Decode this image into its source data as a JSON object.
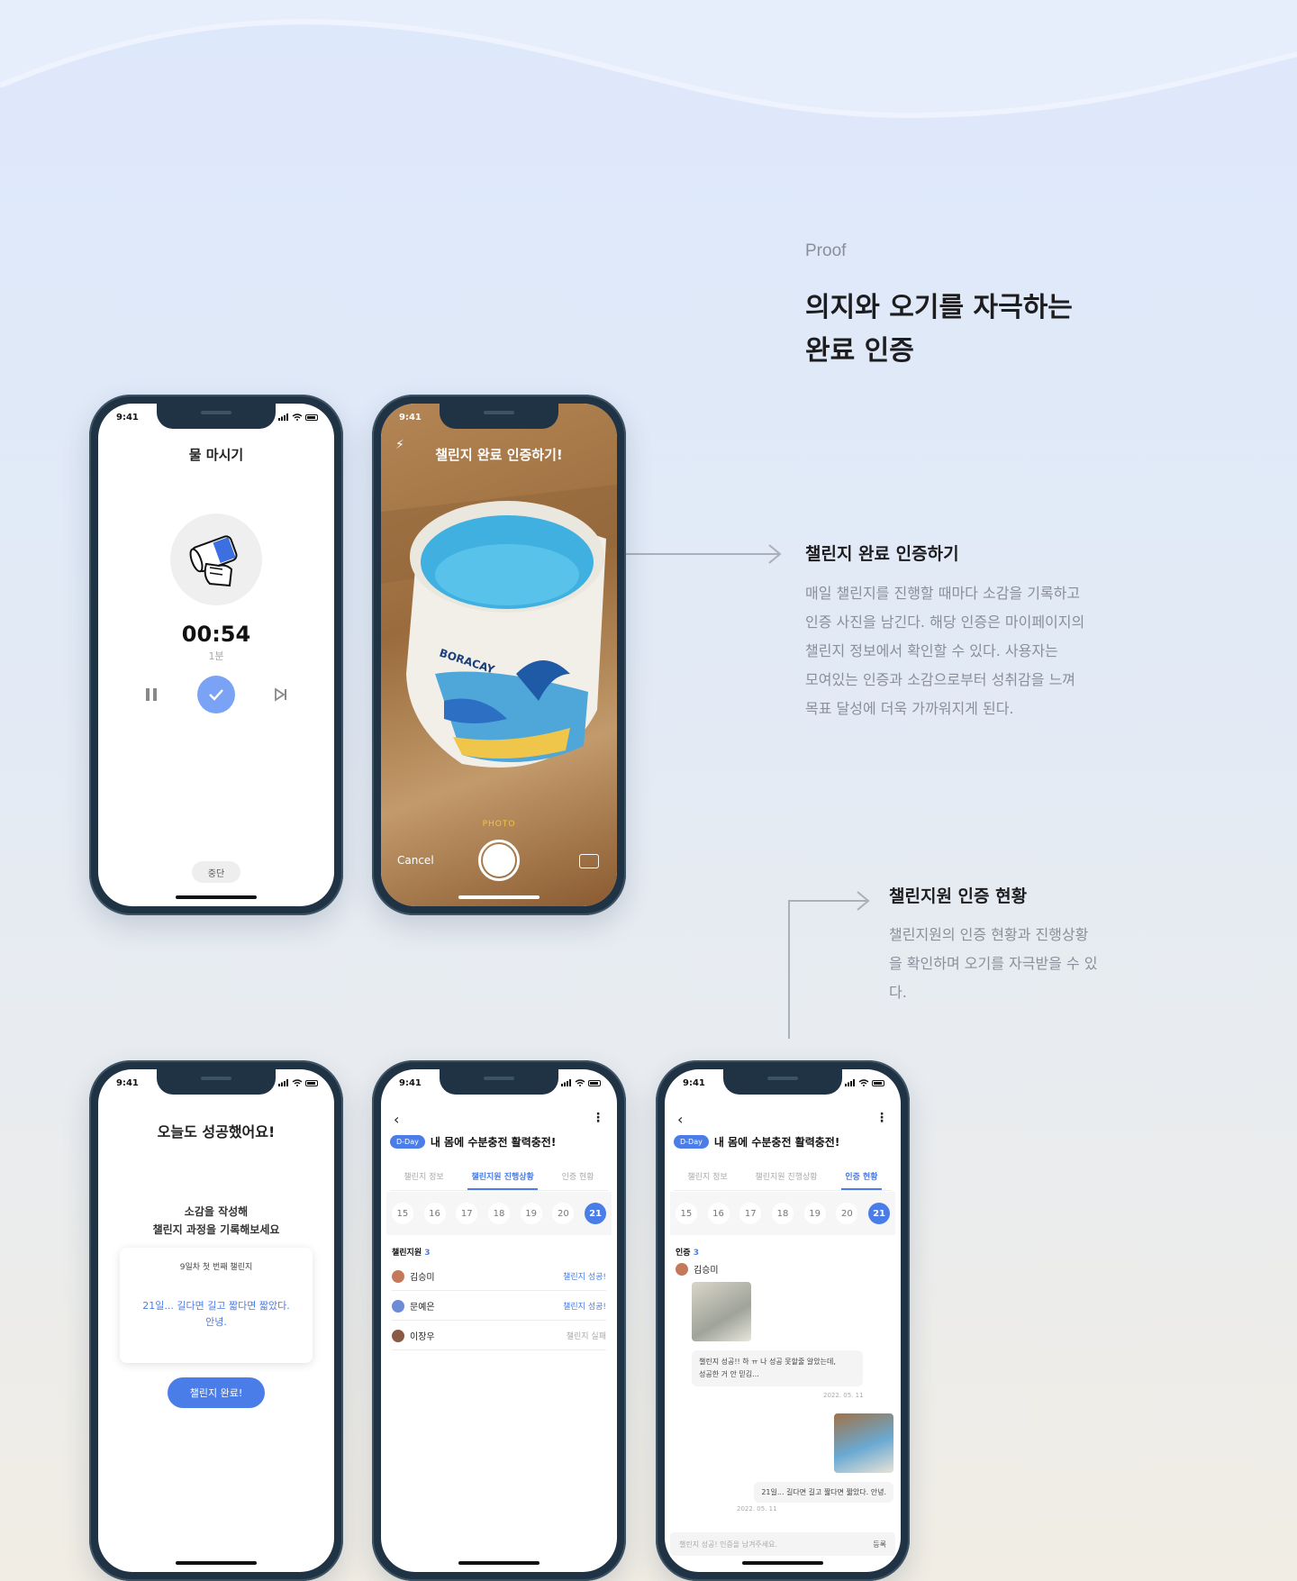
{
  "section": {
    "label": "Proof",
    "title_line1": "의지와 오기를 자극하는",
    "title_line2": "완료 인증"
  },
  "feature1": {
    "title": "챌린지 완료 인증하기",
    "desc_lines": [
      "매일 챌린지를 진행할 때마다 소감을 기록하고",
      "인증 사진을 남긴다. 해당 인증은 마이페이지의",
      "챌린지 정보에서 확인할 수 있다. 사용자는",
      "모여있는 인증과 소감으로부터 성취감을 느껴",
      "목표 달성에 더욱 가까워지게 된다."
    ]
  },
  "feature2": {
    "title": "챌린지원 인증 현황",
    "desc_lines": [
      "챌린지원의 인증 현황과 진행상황",
      "을 확인하며 오기를 자극받을 수 있",
      "다."
    ]
  },
  "status_time": "9:41",
  "phone_timer": {
    "title": "물 마시기",
    "timer": "00:54",
    "sub": "1분",
    "stop_label": "중단",
    "icons": [
      "water-glass-icon",
      "pause-icon",
      "check-icon",
      "skip-icon"
    ]
  },
  "phone_camera": {
    "title": "챌린지 완료 인증하기!",
    "mode": "PHOTO",
    "cancel": "Cancel",
    "photo_text": "BORACAY"
  },
  "phone_complete": {
    "title": "오늘도 성공했어요!",
    "prompt_line1": "소감을 작성해",
    "prompt_line2": "챌린지 과정을 기록해보세요",
    "card_head": "9일차 첫 번째 챌린지",
    "card_line1": "21일... 길다면 길고 짧다면 짧았다.",
    "card_line2": "안녕.",
    "button": "챌린지 완료!"
  },
  "challenge": {
    "dday": "D-Day",
    "name": "내 몸에 수분충전 활력충전!",
    "tabs": [
      "챌린지 정보",
      "챌린지원 진행상황",
      "인증 현황"
    ],
    "dates": [
      "15",
      "16",
      "17",
      "18",
      "19",
      "20",
      "21"
    ],
    "active_date": "21"
  },
  "phone_members": {
    "list_title": "챌린지원",
    "count": "3",
    "members": [
      {
        "name": "김승미",
        "status": "챌린지 성공!"
      },
      {
        "name": "문예은",
        "status": "챌린지 성공!"
      },
      {
        "name": "이장우",
        "status": "챌린지 실패"
      }
    ]
  },
  "phone_feed": {
    "list_title": "인증",
    "count": "3",
    "user": "김승미",
    "comment1_line1": "챌린지 성공!! 하 ㅠ 나 성공 못할줄 알았는데,",
    "comment1_line2": "성공한 거 안 믿김...",
    "date1": "2022. 05. 11",
    "comment2": "21일... 길다면 길고 짧다면 짧았다. 안녕.",
    "date2": "2022. 05. 11",
    "input_placeholder": "챌린지 성공! 인증을 남겨주세요.",
    "submit": "등록"
  },
  "colors": {
    "accent": "#4a7de8",
    "frame": "#1f3345",
    "muted_text": "#8a8f99"
  }
}
